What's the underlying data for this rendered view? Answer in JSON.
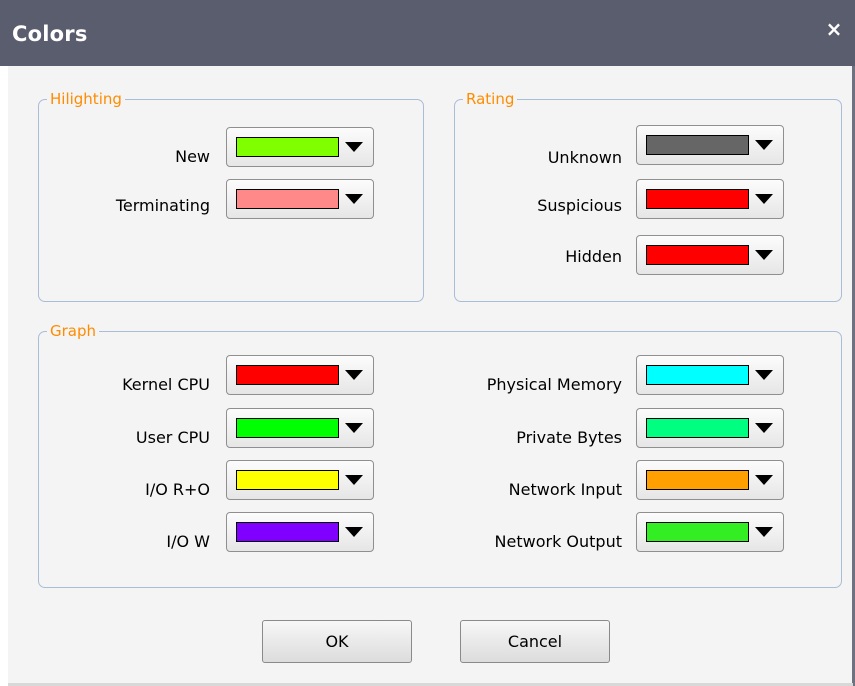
{
  "window": {
    "title": "Colors",
    "close_label": "×"
  },
  "hilighting": {
    "legend": "Hilighting",
    "new": {
      "label": "New",
      "color": "#80ff00"
    },
    "terminating": {
      "label": "Terminating",
      "color": "#ff8888"
    }
  },
  "rating": {
    "legend": "Rating",
    "unknown": {
      "label": "Unknown",
      "color": "#666666"
    },
    "suspicious": {
      "label": "Suspicious",
      "color": "#ff0000"
    },
    "hidden": {
      "label": "Hidden",
      "color": "#ff0000"
    }
  },
  "graph": {
    "legend": "Graph",
    "kernel_cpu": {
      "label": "Kernel CPU",
      "color": "#ff0000"
    },
    "user_cpu": {
      "label": "User CPU",
      "color": "#00ff00"
    },
    "io_ro": {
      "label": "I/O R+O",
      "color": "#ffff00"
    },
    "io_w": {
      "label": "I/O W",
      "color": "#8000ff"
    },
    "physical_memory": {
      "label": "Physical Memory",
      "color": "#00ffff"
    },
    "private_bytes": {
      "label": "Private Bytes",
      "color": "#00ff80"
    },
    "network_input": {
      "label": "Network Input",
      "color": "#ffa000"
    },
    "network_output": {
      "label": "Network Output",
      "color": "#33ee22"
    }
  },
  "buttons": {
    "ok": "OK",
    "cancel": "Cancel"
  }
}
